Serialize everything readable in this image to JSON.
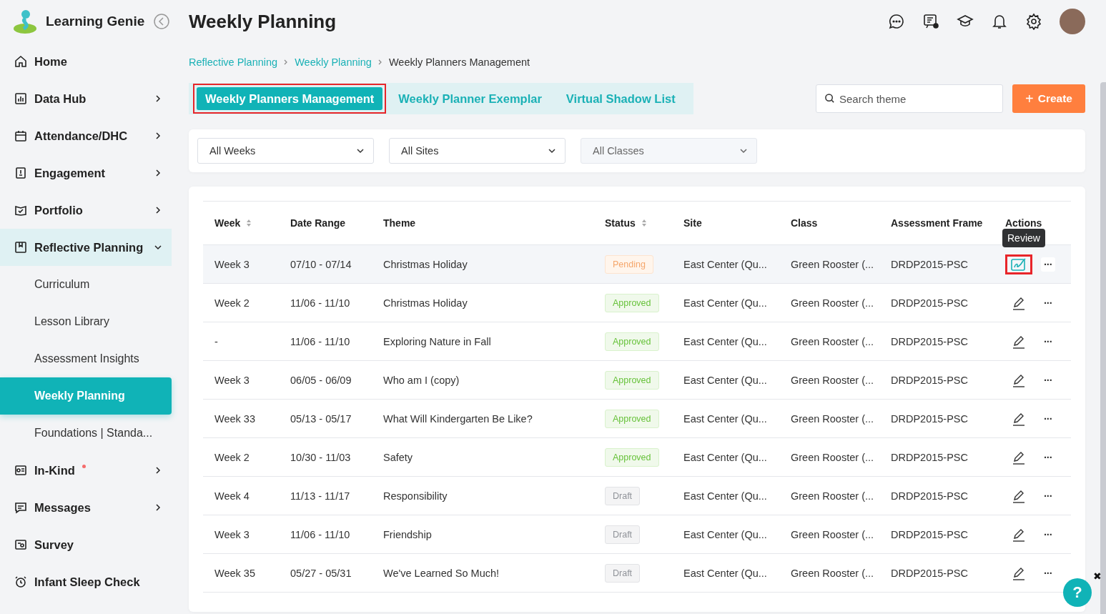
{
  "app": {
    "name": "Learning Genie"
  },
  "page_title": "Weekly Planning",
  "sidebar": {
    "items": [
      {
        "label": "Home",
        "submenu": false,
        "dot": false,
        "expanded": false
      },
      {
        "label": "Data Hub",
        "submenu": true,
        "dot": false,
        "expanded": false
      },
      {
        "label": "Attendance/DHC",
        "submenu": true,
        "dot": false,
        "expanded": false
      },
      {
        "label": "Engagement",
        "submenu": true,
        "dot": false,
        "expanded": false
      },
      {
        "label": "Portfolio",
        "submenu": true,
        "dot": false,
        "expanded": false
      },
      {
        "label": "Reflective Planning",
        "submenu": true,
        "dot": false,
        "expanded": true,
        "children": [
          {
            "label": "Curriculum",
            "selected": false
          },
          {
            "label": "Lesson Library",
            "selected": false
          },
          {
            "label": "Assessment Insights",
            "selected": false
          },
          {
            "label": "Weekly Planning",
            "selected": true
          },
          {
            "label": "Foundations | Standa...",
            "selected": false
          }
        ]
      },
      {
        "label": "In-Kind",
        "submenu": true,
        "dot": true,
        "expanded": false
      },
      {
        "label": "Messages",
        "submenu": true,
        "dot": false,
        "expanded": false
      },
      {
        "label": "Survey",
        "submenu": false,
        "dot": false,
        "expanded": false
      },
      {
        "label": "Infant Sleep Check",
        "submenu": false,
        "dot": false,
        "expanded": false
      }
    ]
  },
  "breadcrumb": [
    "Reflective Planning",
    "Weekly Planning",
    "Weekly Planners Management"
  ],
  "tabs": [
    {
      "label": "Weekly Planners Management",
      "selected": true,
      "highlighted": true
    },
    {
      "label": "Weekly Planner Exemplar",
      "selected": false,
      "highlighted": false
    },
    {
      "label": "Virtual Shadow List",
      "selected": false,
      "highlighted": false
    }
  ],
  "search": {
    "placeholder": "Search theme"
  },
  "create_button": {
    "icon": "+",
    "label": "Create"
  },
  "filters": [
    {
      "value": "All Weeks",
      "disabled": false
    },
    {
      "value": "All Sites",
      "disabled": false
    },
    {
      "value": "All Classes",
      "disabled": true
    }
  ],
  "table": {
    "columns": [
      {
        "label": "Week",
        "sortable": true
      },
      {
        "label": "Date Range",
        "sortable": false
      },
      {
        "label": "Theme",
        "sortable": false
      },
      {
        "label": "Status",
        "sortable": true
      },
      {
        "label": "Site",
        "sortable": false
      },
      {
        "label": "Class",
        "sortable": false
      },
      {
        "label": "Assessment Frame",
        "sortable": false
      },
      {
        "label": "Actions",
        "sortable": false
      }
    ],
    "tooltip": "Review",
    "rows": [
      {
        "week": "Week 3",
        "date_range": "07/10 - 07/14",
        "theme": "Christmas Holiday",
        "status": {
          "label": "Pending",
          "kind": "pending"
        },
        "site": "East Center (Qu...",
        "class": "Green Rooster (...",
        "framework": "DRDP2015-PSC",
        "action": {
          "kind": "review"
        },
        "hovered": true,
        "highlighted": true,
        "more": "···"
      },
      {
        "week": "Week 2",
        "date_range": "11/06 - 11/10",
        "theme": "Christmas Holiday",
        "status": {
          "label": "Approved",
          "kind": "approved"
        },
        "site": "East Center (Qu...",
        "class": "Green Rooster (...",
        "framework": "DRDP2015-PSC",
        "action": {
          "kind": "edit"
        },
        "hovered": false,
        "highlighted": false,
        "more": "···"
      },
      {
        "week": "-",
        "date_range": "11/06 - 11/10",
        "theme": "Exploring Nature in Fall",
        "status": {
          "label": "Approved",
          "kind": "approved"
        },
        "site": "East Center (Qu...",
        "class": "Green Rooster (...",
        "framework": "DRDP2015-PSC",
        "action": {
          "kind": "edit"
        },
        "hovered": false,
        "highlighted": false,
        "more": "···"
      },
      {
        "week": "Week 3",
        "date_range": "06/05 - 06/09",
        "theme": "Who am I (copy)",
        "status": {
          "label": "Approved",
          "kind": "approved"
        },
        "site": "East Center (Qu...",
        "class": "Green Rooster (...",
        "framework": "DRDP2015-PSC",
        "action": {
          "kind": "edit"
        },
        "hovered": false,
        "highlighted": false,
        "more": "···"
      },
      {
        "week": "Week 33",
        "date_range": "05/13 - 05/17",
        "theme": "What Will Kindergarten Be Like?",
        "status": {
          "label": "Approved",
          "kind": "approved"
        },
        "site": "East Center (Qu...",
        "class": "Green Rooster (...",
        "framework": "DRDP2015-PSC",
        "action": {
          "kind": "edit"
        },
        "hovered": false,
        "highlighted": false,
        "more": "···"
      },
      {
        "week": "Week 2",
        "date_range": "10/30 - 11/03",
        "theme": "Safety",
        "status": {
          "label": "Approved",
          "kind": "approved"
        },
        "site": "East Center (Qu...",
        "class": "Green Rooster (...",
        "framework": "DRDP2015-PSC",
        "action": {
          "kind": "edit"
        },
        "hovered": false,
        "highlighted": false,
        "more": "···"
      },
      {
        "week": "Week 4",
        "date_range": "11/13 - 11/17",
        "theme": "Responsibility",
        "status": {
          "label": "Draft",
          "kind": "draft"
        },
        "site": "East Center (Qu...",
        "class": "Green Rooster (...",
        "framework": "DRDP2015-PSC",
        "action": {
          "kind": "edit"
        },
        "hovered": false,
        "highlighted": false,
        "more": "···"
      },
      {
        "week": "Week 3",
        "date_range": "11/06 - 11/10",
        "theme": "Friendship",
        "status": {
          "label": "Draft",
          "kind": "draft"
        },
        "site": "East Center (Qu...",
        "class": "Green Rooster (...",
        "framework": "DRDP2015-PSC",
        "action": {
          "kind": "edit"
        },
        "hovered": false,
        "highlighted": false,
        "more": "···"
      },
      {
        "week": "Week 35",
        "date_range": "05/27 - 05/31",
        "theme": "We've Learned So Much!",
        "status": {
          "label": "Draft",
          "kind": "draft"
        },
        "site": "East Center (Qu...",
        "class": "Green Rooster (...",
        "framework": "DRDP2015-PSC",
        "action": {
          "kind": "edit"
        },
        "hovered": false,
        "highlighted": false,
        "more": "···"
      }
    ]
  },
  "help": {
    "label": "?",
    "close": "✖"
  }
}
